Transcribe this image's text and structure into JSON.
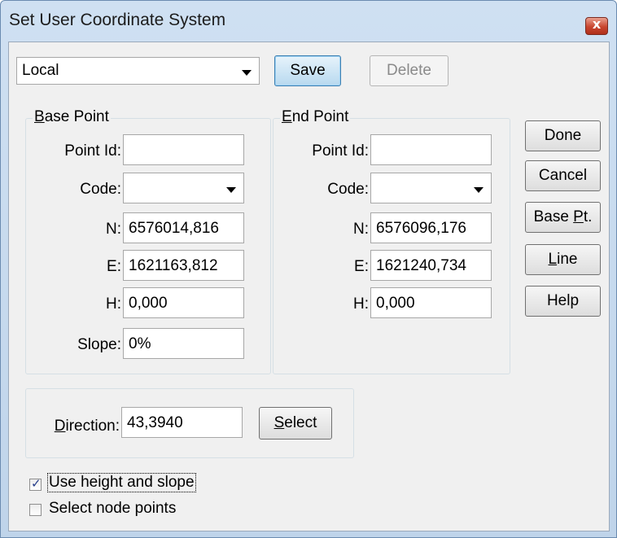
{
  "window": {
    "title": "Set User Coordinate System",
    "close_glyph": "x"
  },
  "system": {
    "selected": "Local",
    "save_label": "Save",
    "delete_label": "Delete"
  },
  "base_point": {
    "legend_accel": "B",
    "legend_rest": "ase Point",
    "point_id_label": "Point Id:",
    "point_id": "",
    "code_label": "Code:",
    "code": "",
    "n_label": "N:",
    "n": "6576014,816",
    "e_label": "E:",
    "e": "1621163,812",
    "h_label": "H:",
    "h": "0,000",
    "slope_label": "Slope:",
    "slope": "0%"
  },
  "end_point": {
    "legend_accel": "E",
    "legend_rest": "nd Point",
    "point_id_label": "Point Id:",
    "point_id": "",
    "code_label": "Code:",
    "code": "",
    "n_label": "N:",
    "n": "6576096,176",
    "e_label": "E:",
    "e": "1621240,734",
    "h_label": "H:",
    "h": "0,000"
  },
  "side_buttons": {
    "done": "Done",
    "cancel": "Cancel",
    "base_pt_pre": "Base ",
    "base_pt_accel": "P",
    "base_pt_post": "t.",
    "line_accel": "L",
    "line_post": "ine",
    "help": "Help"
  },
  "direction": {
    "label_accel": "D",
    "label_rest": "irection:",
    "value": "43,3940",
    "select_accel": "S",
    "select_rest": "elect"
  },
  "options": {
    "use_height_label": "Use height and slope",
    "use_height_checked": true,
    "select_nodes_label": "Select node points",
    "select_nodes_checked": false
  },
  "icons": {
    "dropdown": "chevron-down-icon",
    "check": "checkmark-icon"
  }
}
